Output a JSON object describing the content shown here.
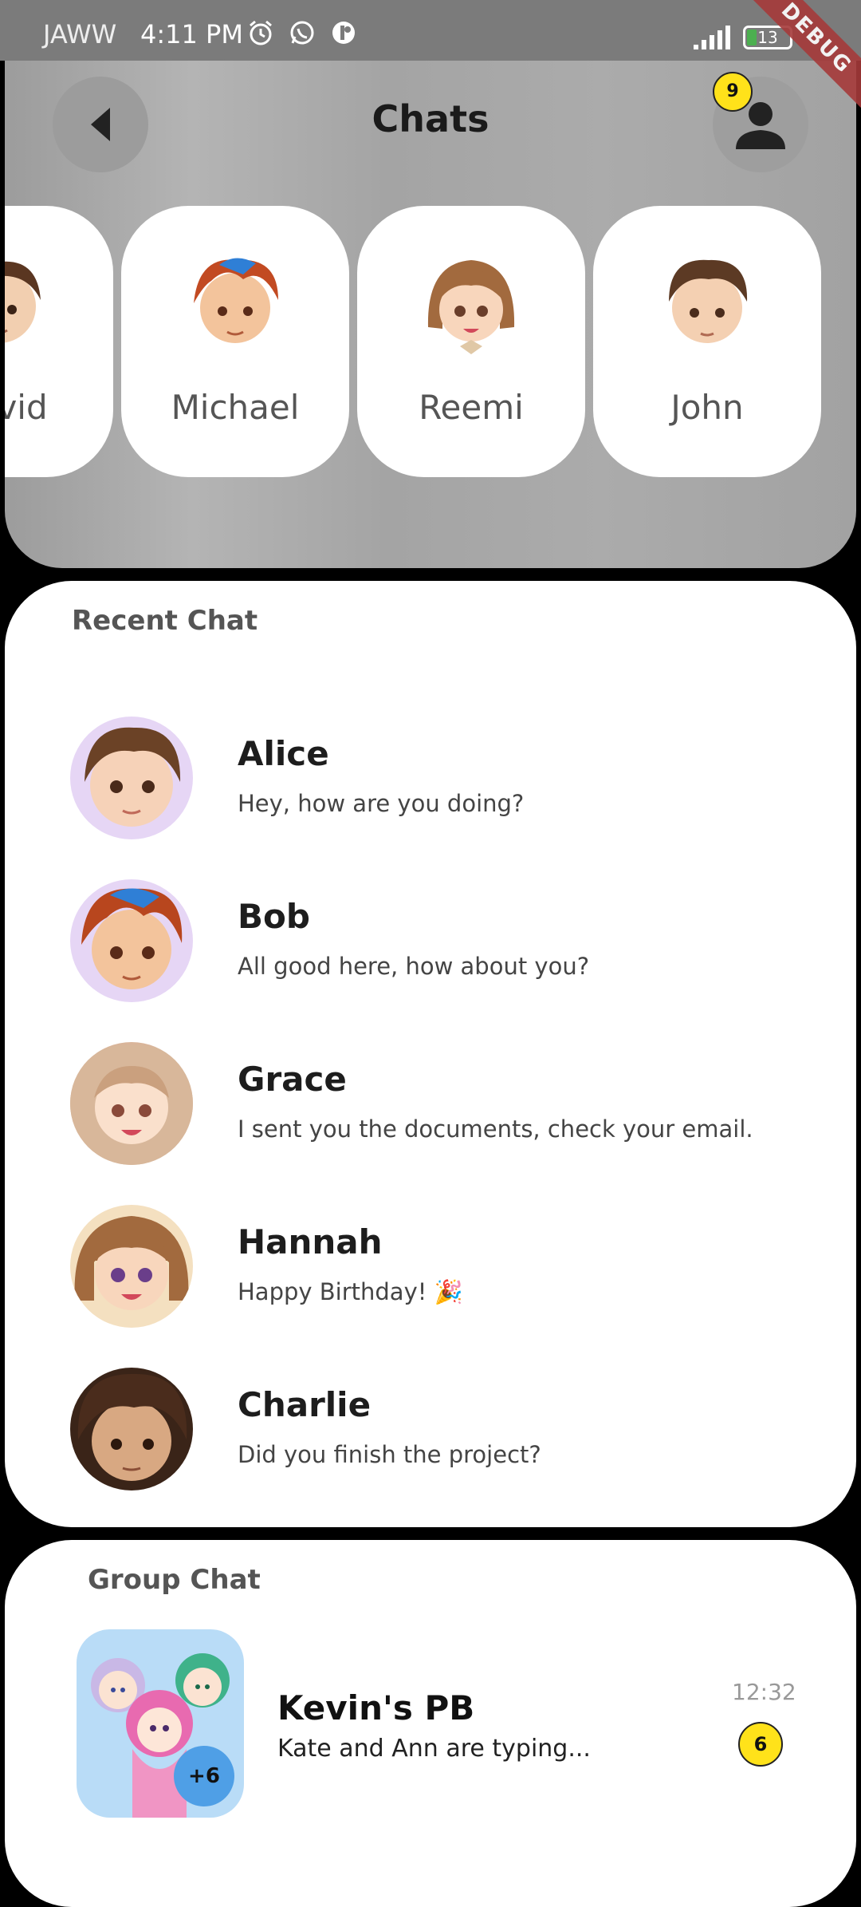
{
  "status_bar": {
    "carrier": "JAWW",
    "time": "4:11 PM",
    "icons": [
      "alarm-icon",
      "whatsapp-icon",
      "app-notification-icon",
      "signal-icon"
    ],
    "battery": "13",
    "debug_label": "DEBUG"
  },
  "header": {
    "title": "Chats",
    "back_icon": "back-arrow-icon",
    "profile_icon": "person-icon",
    "notification_count": "9"
  },
  "stories": [
    {
      "name": "David"
    },
    {
      "name": "Michael"
    },
    {
      "name": "Reemi"
    },
    {
      "name": "John"
    }
  ],
  "recent_chat": {
    "label": "Recent Chat",
    "items": [
      {
        "name": "Alice",
        "message": "Hey, how are you doing?"
      },
      {
        "name": "Bob",
        "message": "All good here, how about you?"
      },
      {
        "name": "Grace",
        "message": "I sent you the documents, check your email."
      },
      {
        "name": "Hannah",
        "message": "Happy Birthday! 🎉"
      },
      {
        "name": "Charlie",
        "message": "Did you finish the project?"
      }
    ]
  },
  "group_chat": {
    "label": "Group Chat",
    "name": "Kevin's PB",
    "message": "Kate and Ann are typing...",
    "time": "12:32",
    "unread": "6",
    "extra_members": "+6"
  },
  "colors": {
    "badge_yellow": "#ffe21a",
    "panel_grey": "#a8a8a8",
    "group_avatar_bg": "#b9dcf7",
    "more_badge_blue": "#4f9fe6"
  }
}
